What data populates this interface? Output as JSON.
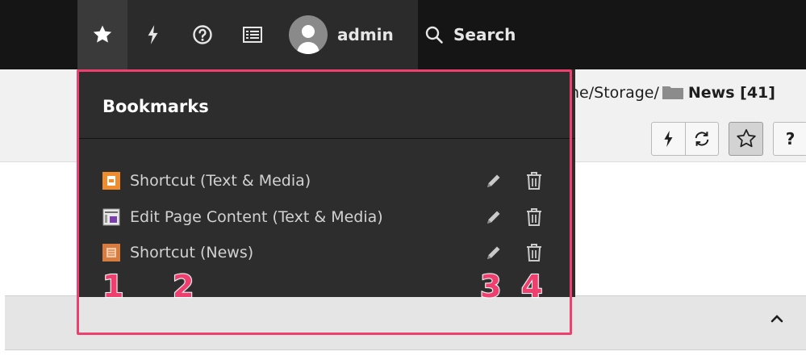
{
  "toolbar": {
    "username": "admin",
    "search_label": "Search",
    "icons": [
      "star-icon",
      "flash-icon",
      "help-icon",
      "list-icon",
      "user-avatar-icon",
      "search-icon"
    ]
  },
  "docheader": {
    "path_prefix": "ne/Storage/",
    "path_title": "News [41]",
    "buttons": [
      "flash-icon",
      "refresh-icon",
      "star-outline-icon"
    ],
    "help_label": "?"
  },
  "bookmarks": {
    "title": "Bookmarks",
    "items": [
      {
        "label": "Shortcut (Text & Media)",
        "icon": "shortcut-page-icon",
        "icon_color": "#f08c2c"
      },
      {
        "label": "Edit Page Content (Text & Media)",
        "icon": "edit-content-icon",
        "icon_color": "#7a3fa8"
      },
      {
        "label": "Shortcut (News)",
        "icon": "shortcut-news-icon",
        "icon_color": "#d87b3e"
      }
    ]
  },
  "annotations": [
    "1",
    "2",
    "3",
    "4"
  ],
  "colors": {
    "accent": "#ee3f6f",
    "topbar": "#151515",
    "dropdown": "#2d2d2d"
  }
}
